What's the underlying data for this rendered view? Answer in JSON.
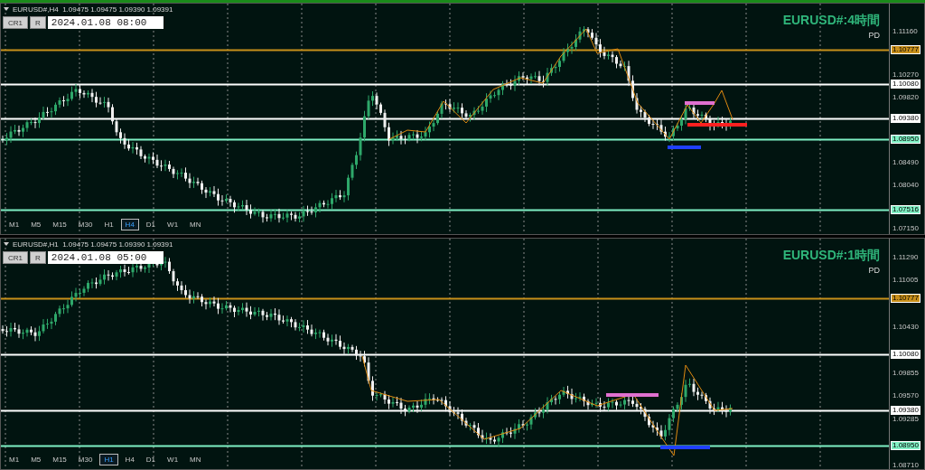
{
  "panels": [
    {
      "header": "EURUSD#,H4  1.09475 1.09475 1.09390 1.09391",
      "toolbar": {
        "buttons": [
          "CR1",
          "R"
        ],
        "datetime": "2024.01.08 08:00"
      },
      "title": "EURUSD#:4時間",
      "subtitle": "PD",
      "axis_ticks": [
        "1.11160",
        "1.10270",
        "1.09820",
        "1.08490",
        "1.08040",
        "1.07150"
      ],
      "levels": [
        {
          "label": "1.10777",
          "color": "#c8901a"
        },
        {
          "label": "1.10080",
          "color": "#ffffff"
        },
        {
          "label": "1.09380",
          "color": "#ffffff"
        },
        {
          "label": "1.08950",
          "color": "#7ff0c4"
        },
        {
          "label": "1.07516",
          "color": "#7ff0c4"
        }
      ],
      "timeframes": [
        {
          "label": "M1",
          "selected": false
        },
        {
          "label": "M5",
          "selected": false
        },
        {
          "label": "M15",
          "selected": false
        },
        {
          "label": "M30",
          "selected": false
        },
        {
          "label": "H1",
          "selected": false
        },
        {
          "label": "H4",
          "selected": true
        },
        {
          "label": "D1",
          "selected": false
        },
        {
          "label": "W1",
          "selected": false
        },
        {
          "label": "MN",
          "selected": false
        }
      ]
    },
    {
      "header": "EURUSD#,H1  1.09475 1.09475 1.09390 1.09391",
      "toolbar": {
        "buttons": [
          "CR1",
          "R"
        ],
        "datetime": "2024.01.08 05:00"
      },
      "title": "EURUSD#:1時間",
      "subtitle": "PD",
      "axis_ticks": [
        "1.11290",
        "1.11005",
        "1.10430",
        "1.09855",
        "1.09570",
        "1.09285",
        "1.08710"
      ],
      "levels": [
        {
          "label": "1.10777",
          "color": "#c8901a"
        },
        {
          "label": "1.10080",
          "color": "#ffffff"
        },
        {
          "label": "1.09380",
          "color": "#ffffff"
        },
        {
          "label": "1.08950",
          "color": "#7ff0c4"
        }
      ],
      "timeframes": [
        {
          "label": "M1",
          "selected": false
        },
        {
          "label": "M5",
          "selected": false
        },
        {
          "label": "M15",
          "selected": false
        },
        {
          "label": "M30",
          "selected": false
        },
        {
          "label": "H1",
          "selected": true
        },
        {
          "label": "H4",
          "selected": false
        },
        {
          "label": "D1",
          "selected": false
        },
        {
          "label": "W1",
          "selected": false
        },
        {
          "label": "MN",
          "selected": false
        }
      ]
    }
  ]
}
